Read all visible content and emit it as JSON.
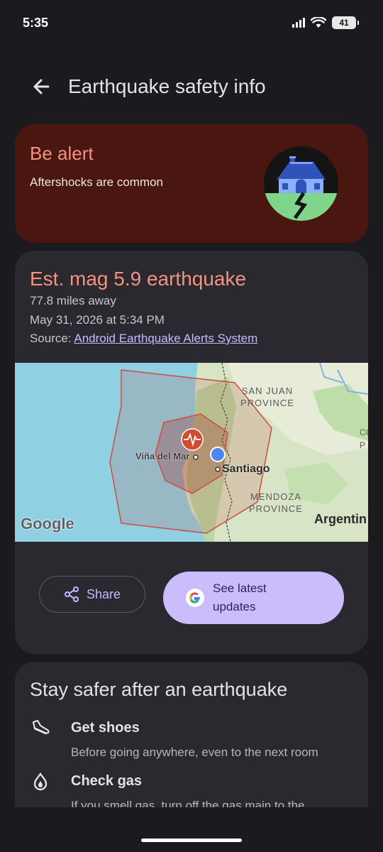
{
  "status": {
    "time": "5:35",
    "battery": "41"
  },
  "header": {
    "title": "Earthquake safety info",
    "back_icon": "arrow-left-icon"
  },
  "alert": {
    "title": "Be alert",
    "subtitle": "Aftershocks are common",
    "colors": {
      "bg": "#4a1610",
      "title": "#f2927f"
    }
  },
  "quake": {
    "title": "Est. mag 5.9 earthquake",
    "distance": "77.8 miles away",
    "datetime": "May 31, 2026 at 5:34 PM",
    "source_prefix": "Source: ",
    "source_link": "Android Earthquake Alerts System"
  },
  "map": {
    "labels": {
      "san_juan_1": "SAN JUAN",
      "san_juan_2": "PROVINCE",
      "vina": "Viña del Mar",
      "santiago": "Santiago",
      "mendoza_1": "MENDOZA",
      "mendoza_2": "PROVINCE",
      "argentina": "Argentin",
      "co": "CO",
      "p": "P",
      "google": "Google"
    }
  },
  "actions": {
    "share_label": "Share",
    "latest_label": "See latest updates"
  },
  "tips": {
    "title": "Stay safer after an earthquake",
    "items": [
      {
        "icon": "shoe-icon",
        "title": "Get shoes",
        "desc": "Before going anywhere, even to the next room"
      },
      {
        "icon": "gas-flame-icon",
        "title": "Check gas",
        "desc": "If you smell gas, turn off the gas main to the"
      }
    ]
  },
  "colors": {
    "background": "#1b1a1f",
    "card": "#2a292f",
    "accent": "#c8b8ff",
    "button": "#cbbdfb"
  }
}
